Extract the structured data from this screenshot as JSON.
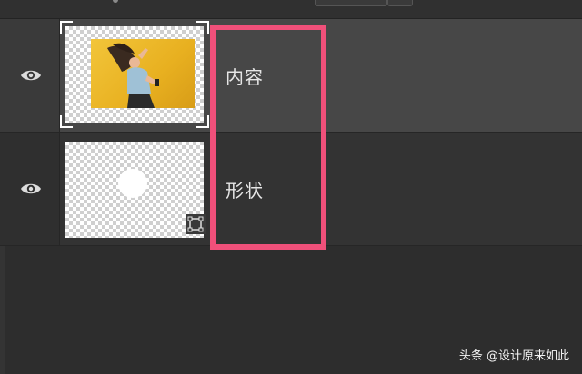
{
  "layers_panel": {
    "layers": [
      {
        "name": "内容",
        "visible": true,
        "selected": true,
        "thumbnail": "photo"
      },
      {
        "name": "形状",
        "visible": true,
        "selected": false,
        "thumbnail": "shape"
      }
    ]
  },
  "highlight": {
    "color": "#f0507a"
  },
  "watermark": {
    "text": "头条 @设计原来如此"
  },
  "colors": {
    "panel_bg": "#2d2d2d",
    "selected_row": "#474747",
    "row": "#333333"
  }
}
